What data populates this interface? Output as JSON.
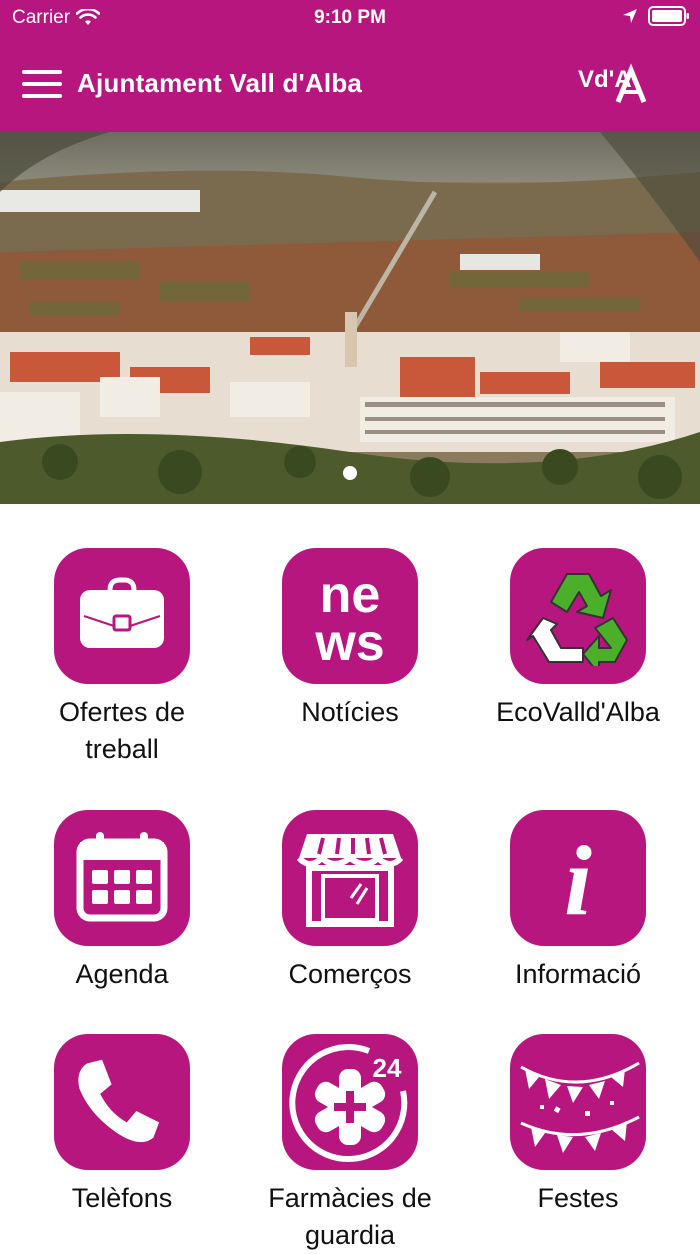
{
  "status_bar": {
    "carrier": "Carrier",
    "time": "9:10 PM"
  },
  "header": {
    "title": "Ajuntament Vall d'Alba",
    "logo_text": "Vd'A",
    "menu_icon": "hamburger-menu-icon"
  },
  "colors": {
    "brand": "#b8167f",
    "recycle_green": "#4caf2a"
  },
  "carousel": {
    "page_count": 1,
    "active_index": 0
  },
  "tiles": [
    {
      "label": "Ofertes de treball",
      "icon": "briefcase-icon"
    },
    {
      "label": "Notícies",
      "icon": "news-icon",
      "icon_text": [
        "ne",
        "ws"
      ]
    },
    {
      "label": "EcoValld'Alba",
      "icon": "recycle-icon"
    },
    {
      "label": "Agenda",
      "icon": "calendar-icon"
    },
    {
      "label": "Comerços",
      "icon": "storefront-icon"
    },
    {
      "label": "Informació",
      "icon": "info-icon",
      "icon_text": "i"
    },
    {
      "label": "Telèfons",
      "icon": "phone-icon"
    },
    {
      "label": "Farmàcies de guardia",
      "icon": "pharmacy-24h-icon",
      "icon_text": "24"
    },
    {
      "label": "Festes",
      "icon": "festive-bunting-icon"
    }
  ]
}
